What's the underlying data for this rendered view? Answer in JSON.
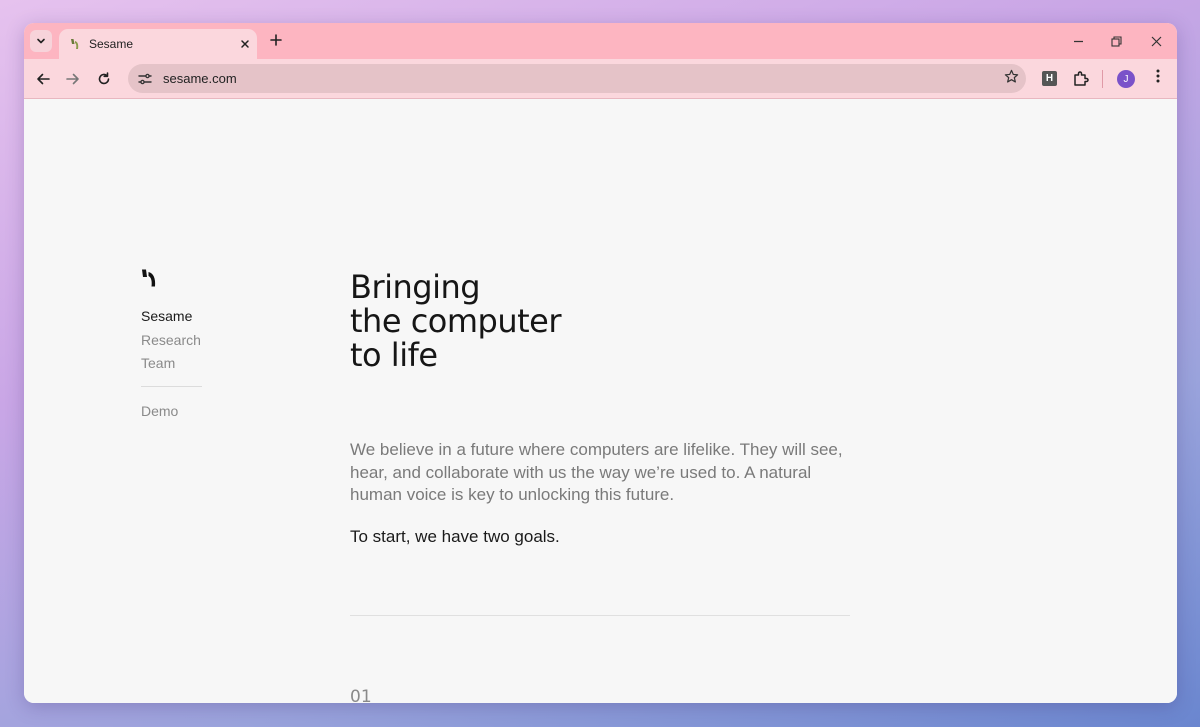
{
  "browser": {
    "tab": {
      "title": "Sesame"
    },
    "address_bar": {
      "url": "sesame.com"
    },
    "extension_badge": "H",
    "profile_initial": "J"
  },
  "colors": {
    "tabstrip": "#fdb5c1",
    "toolbar": "#fbd7dd",
    "omnibox": "#e5c3c8",
    "page_bg": "#f7f7f7",
    "avatar": "#7a52c9"
  },
  "sidebar": {
    "items": [
      {
        "label": "Sesame",
        "active": true
      },
      {
        "label": "Research",
        "active": false
      },
      {
        "label": "Team",
        "active": false
      }
    ],
    "demo_label": "Demo"
  },
  "main": {
    "headline_lines": [
      "Bringing",
      "the computer",
      "to life"
    ],
    "intro": "We believe in a future where computers are lifelike. They will see, hear, and collaborate with us the way we’re used to. A natural human voice is key to unlocking this future.",
    "goals": "To start, we have two goals.",
    "section_number": "01"
  },
  "icons": {
    "tab_search": "chevron-down-icon",
    "close": "close-icon",
    "new_tab": "plus-icon",
    "back": "arrow-left-icon",
    "forward": "arrow-right-icon",
    "reload": "reload-icon",
    "site_settings": "tune-icon",
    "bookmark": "star-icon",
    "extensions": "puzzle-icon",
    "menu": "kebab-menu-icon"
  }
}
